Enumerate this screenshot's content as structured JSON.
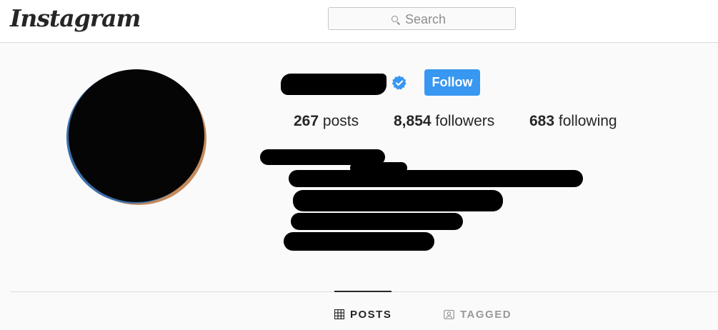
{
  "header": {
    "logo": "Instagram",
    "search": {
      "placeholder": "Search",
      "icon": "search-icon"
    }
  },
  "profile": {
    "verified_icon": "verified-badge-icon",
    "follow_label": "Follow",
    "stats": {
      "posts": {
        "count": "267",
        "label": "posts"
      },
      "followers": {
        "count": "8,854",
        "label": "followers"
      },
      "following": {
        "count": "683",
        "label": "following"
      }
    }
  },
  "tabs": [
    {
      "label": "POSTS",
      "icon": "grid-icon",
      "active": true
    },
    {
      "label": "TAGGED",
      "icon": "tagged-icon",
      "active": false
    }
  ],
  "colors": {
    "accent": "#3897f0",
    "text": "#262626",
    "muted": "#999999",
    "border": "#dbdbdb",
    "background": "#fafafa"
  }
}
